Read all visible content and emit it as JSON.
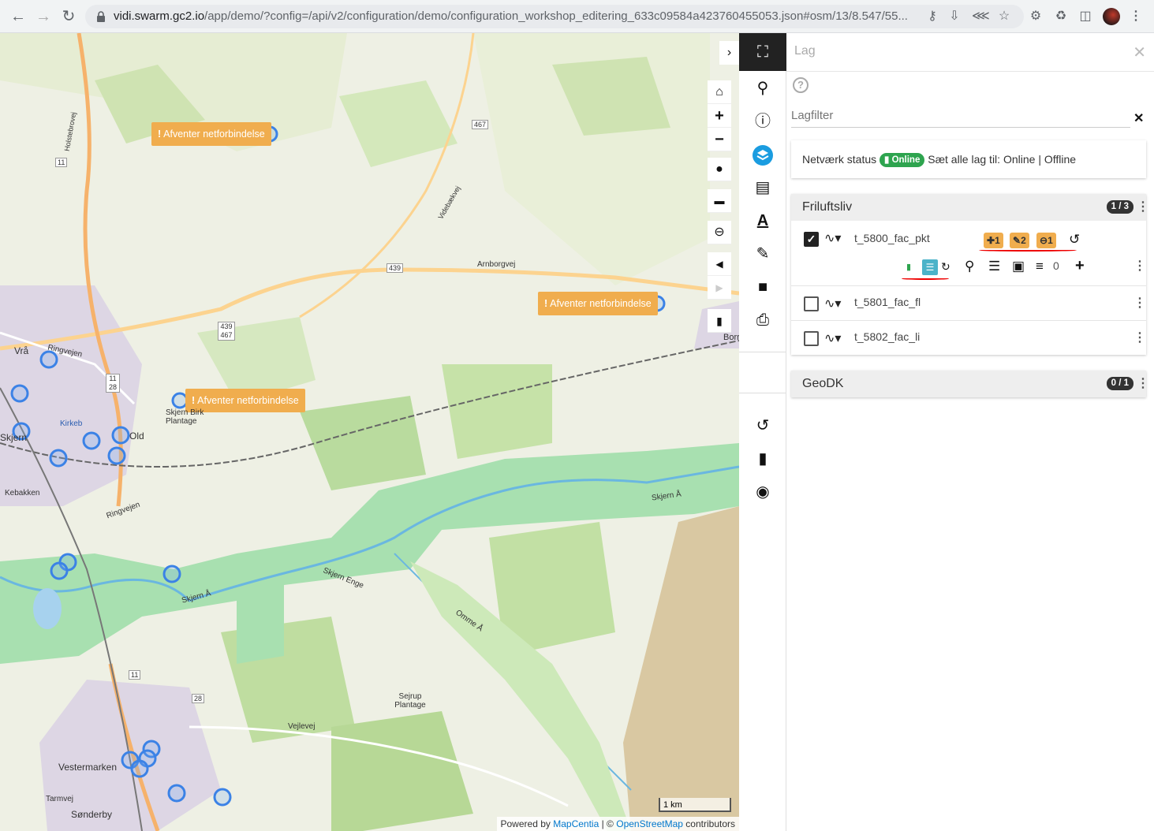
{
  "browser": {
    "url_host": "vidi.swarm.gc2.io",
    "url_path": "/app/demo/?config=/api/v2/configuration/demo/configuration_workshop_editering_633c09584a423760455053.json#osm/13/8.547/55..."
  },
  "map": {
    "warnings": [
      "Afventer netforbindelse",
      "Afventer netforbindelse",
      "Afventer netforbindelse"
    ],
    "places": [
      "Vrå",
      "Skjern",
      "Old",
      "Vestermarken",
      "Sønderby",
      "Skjern Enge",
      "Skjern Å",
      "Omme Å",
      "Sejrup Plantage",
      "Skjern Birk Plantage",
      "Arnborgvej",
      "Ringvejen",
      "Vejlevej",
      "Tarmvej",
      "Borr",
      "Kirkeb",
      "Kebakken",
      "Skjern Å",
      "Videbækvej",
      "Holstebrovej",
      "Ringvejen"
    ],
    "road_numbers": [
      "467",
      "11",
      "439",
      "439 / 467",
      "11 / 28",
      "11",
      "28"
    ],
    "scale_label": "1 km",
    "attribution": {
      "prefix": "Powered by",
      "mapcentia": "MapCentia",
      "sep": "| ©",
      "osm": "OpenStreetMap",
      "suffix": "contributors"
    }
  },
  "rail": {
    "icons": [
      "fullscreen-icon",
      "search-icon",
      "info-icon",
      "layers-icon",
      "map-icon",
      "text-icon",
      "pencil-icon",
      "folder-icon",
      "print-icon",
      "undo-icon",
      "chat-icon",
      "lock-icon"
    ]
  },
  "panel": {
    "title": "Lag",
    "filter_placeholder": "Lagfilter",
    "network": {
      "label": "Netværk status",
      "status": "Online",
      "set_all_prefix": "Sæt alle lag til:",
      "online": "Online",
      "sep": "|",
      "offline": "Offline"
    },
    "groups": [
      {
        "name": "Friluftsliv",
        "count": "1 / 3",
        "layers": [
          {
            "name": "t_5800_fac_pkt",
            "checked": true,
            "badges": {
              "added": "1",
              "edited": "2",
              "deleted": "1"
            },
            "filter_count": "0"
          },
          {
            "name": "t_5801_fac_fl",
            "checked": false
          },
          {
            "name": "t_5802_fac_li",
            "checked": false
          }
        ]
      },
      {
        "name": "GeoDK",
        "count": "0 / 1"
      }
    ]
  },
  "colors": {
    "accent": "#1a9ce0",
    "warning": "#f0ad4e",
    "online": "#2ea44f",
    "wetland": "#a8e0b0"
  }
}
